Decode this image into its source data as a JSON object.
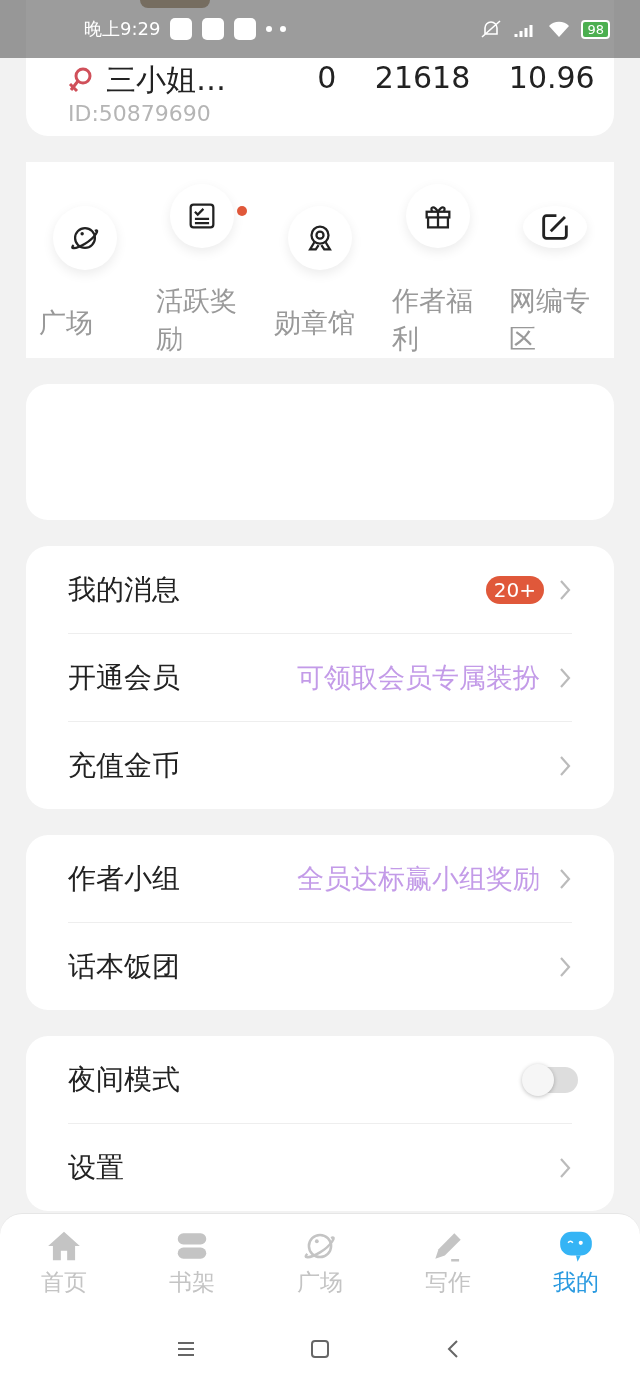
{
  "status_bar": {
    "time": "晚上9:29",
    "battery": "98"
  },
  "profile": {
    "name": "三小姐…",
    "id": "ID:50879690",
    "stats": [
      "0",
      "21618",
      "10.96"
    ]
  },
  "shortcuts": [
    {
      "label": "广场",
      "dot": false
    },
    {
      "label": "活跃奖励",
      "dot": true
    },
    {
      "label": "勋章馆",
      "dot": false
    },
    {
      "label": "作者福利",
      "dot": false
    },
    {
      "label": "网编专区",
      "dot": false
    }
  ],
  "menu_groups": [
    [
      {
        "kind": "link",
        "label": "我的消息",
        "badge": "20+"
      },
      {
        "kind": "link",
        "label": "开通会员",
        "hint": "可领取会员专属装扮"
      },
      {
        "kind": "link",
        "label": "充值金币"
      }
    ],
    [
      {
        "kind": "link",
        "label": "作者小组",
        "hint": "全员达标赢小组奖励"
      },
      {
        "kind": "link",
        "label": "话本饭团"
      }
    ],
    [
      {
        "kind": "toggle",
        "label": "夜间模式",
        "on": false
      },
      {
        "kind": "link",
        "label": "设置"
      }
    ]
  ],
  "tab_bar": [
    {
      "label": "首页",
      "selected": false
    },
    {
      "label": "书架",
      "selected": false
    },
    {
      "label": "广场",
      "selected": false
    },
    {
      "label": "写作",
      "selected": false
    },
    {
      "label": "我的",
      "selected": true
    }
  ]
}
